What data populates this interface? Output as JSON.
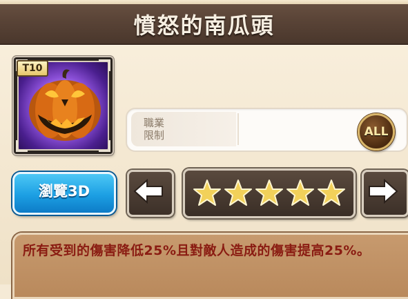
{
  "header": {
    "title": "憤怒的南瓜頭"
  },
  "item": {
    "tier": "T10",
    "icon": "jack-o-lantern-icon"
  },
  "class_restriction": {
    "label_line1": "職業",
    "label_line2": "限制",
    "badge": "ALL"
  },
  "actions": {
    "preview_label": "瀏覽3D"
  },
  "rating": {
    "stars": 5,
    "max_stars": 5,
    "star_color": "#f2d15a"
  },
  "description": {
    "text": "所有受到的傷害降低25%且對敵人造成的傷害提高25%。"
  },
  "colors": {
    "title_bar": "#5a4437",
    "preview_button": "#1c9fe3",
    "description_text": "#8a1c12",
    "description_bg": "#c79a6e"
  }
}
